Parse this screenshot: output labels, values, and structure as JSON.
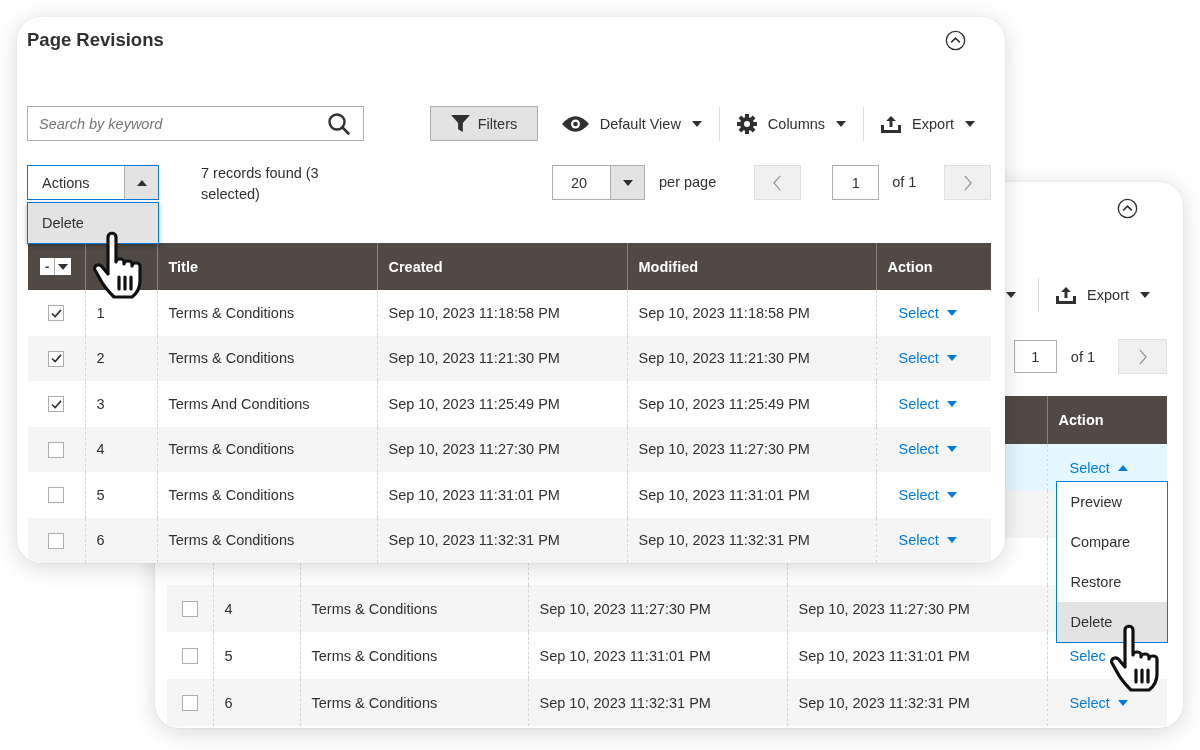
{
  "front_panel": {
    "title": "Page Revisions",
    "search": {
      "placeholder": "Search by keyword"
    },
    "filters_button": "Filters",
    "view_menu": "Default View",
    "columns_menu": "Columns",
    "export_menu": "Export",
    "mass_actions": {
      "label": "Actions",
      "expanded": true,
      "options": [
        {
          "label": "Delete",
          "hovered": true
        }
      ]
    },
    "records_found": "7 records found (3 selected)",
    "per_page": {
      "value": "20",
      "label": "per page"
    },
    "pagination": {
      "page": "1",
      "total": "of 1"
    },
    "table": {
      "select_all": "-",
      "columns": [
        "Title",
        "Created",
        "Modified",
        "Action"
      ],
      "rows": [
        {
          "checked": true,
          "id": "1",
          "title": "Terms & Conditions",
          "created": "Sep 10, 2023 11:18:58 PM",
          "modified": "Sep 10, 2023 11:18:58 PM",
          "action": "Select",
          "expanded": false
        },
        {
          "checked": true,
          "id": "2",
          "title": "Terms & Conditions",
          "created": "Sep 10, 2023 11:21:30 PM",
          "modified": "Sep 10, 2023 11:21:30 PM",
          "action": "Select",
          "expanded": false
        },
        {
          "checked": true,
          "id": "3",
          "title": "Terms And Conditions",
          "created": "Sep 10, 2023 11:25:49 PM",
          "modified": "Sep 10, 2023 11:25:49 PM",
          "action": "Select",
          "expanded": false
        },
        {
          "checked": false,
          "id": "4",
          "title": "Terms & Conditions",
          "created": "Sep 10, 2023 11:27:30 PM",
          "modified": "Sep 10, 2023 11:27:30 PM",
          "action": "Select",
          "expanded": false
        },
        {
          "checked": false,
          "id": "5",
          "title": "Terms & Conditions",
          "created": "Sep 10, 2023 11:31:01 PM",
          "modified": "Sep 10, 2023 11:31:01 PM",
          "action": "Select",
          "expanded": false
        },
        {
          "checked": false,
          "id": "6",
          "title": "Terms & Conditions",
          "created": "Sep 10, 2023 11:32:31 PM",
          "modified": "Sep 10, 2023 11:32:31 PM",
          "action": "Select",
          "expanded": false
        }
      ]
    }
  },
  "back_panel": {
    "export_menu": "Export",
    "pagination": {
      "page": "1",
      "total": "of 1"
    },
    "table": {
      "columns": [
        "Action"
      ],
      "rows": [
        {
          "highlighted": true,
          "action": "Select",
          "expanded": true
        },
        {
          "highlighted": false
        },
        {
          "highlighted": false
        },
        {
          "highlighted": false,
          "checked": false,
          "id": "4",
          "title": "Terms & Conditions",
          "created": "Sep 10, 2023 11:27:30 PM",
          "modified": "Sep 10, 2023 11:27:30 PM"
        },
        {
          "highlighted": false,
          "checked": false,
          "id": "5",
          "title": "Terms & Conditions",
          "created": "Sep 10, 2023 11:31:01 PM",
          "modified": "Sep 10, 2023 11:31:01 PM",
          "action": "Selec"
        },
        {
          "highlighted": false,
          "checked": false,
          "id": "6",
          "title": "Terms & Conditions",
          "created": "Sep 10, 2023 11:32:31 PM",
          "modified": "Sep 10, 2023 11:32:31 PM",
          "action": "Select",
          "expanded": false
        }
      ]
    },
    "action_menu": [
      {
        "label": "Preview",
        "hovered": false
      },
      {
        "label": "Compare",
        "hovered": false
      },
      {
        "label": "Restore",
        "hovered": false
      },
      {
        "label": "Delete",
        "hovered": true
      }
    ]
  }
}
